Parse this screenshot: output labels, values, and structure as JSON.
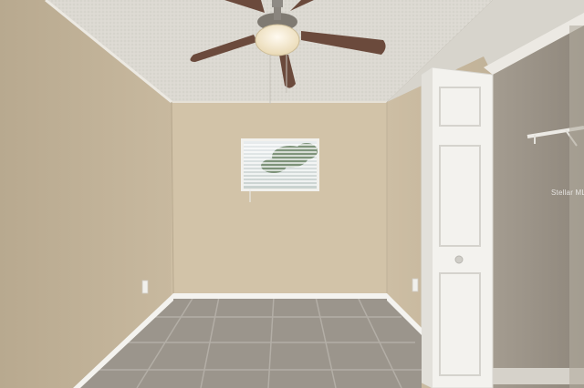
{
  "photo": {
    "watermark_text": "Stellar MLS",
    "objects": [
      "ceiling-fan-icon",
      "window-blinds",
      "paneled-door",
      "closet-shelf",
      "tile-floor",
      "wall-outlet"
    ]
  },
  "colors": {
    "ceiling": "#d9d6cf",
    "wall_back": "#d2c3a8",
    "wall_left": "#c2b39a",
    "wall_right": "#c8b99f",
    "closet_interior": "#9e968a",
    "floor_tile": "#9b958c",
    "grout": "#b3aea6",
    "door": "#f3f2ee",
    "trim": "#f4f3ef",
    "fan_blade": "#6b4a3c",
    "fan_light": "#f2e6c8"
  }
}
